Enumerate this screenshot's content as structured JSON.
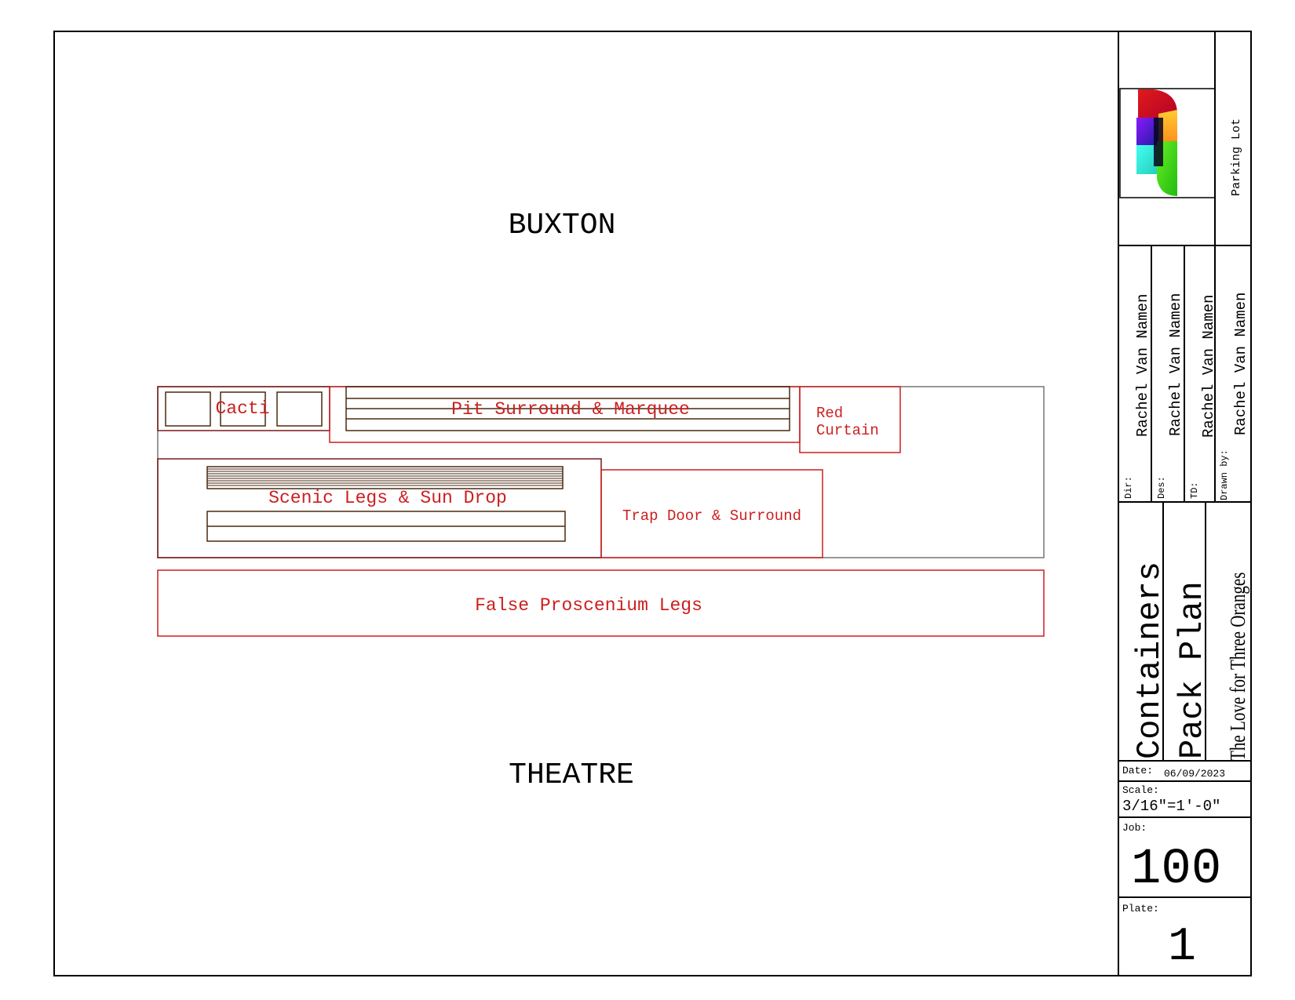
{
  "plan": {
    "top_label": "BUXTON",
    "bottom_label": "THEATRE",
    "containers": {
      "cacti": "Cacti",
      "pit": "Pit Surround & Marquee",
      "red_curtain_line1": "Red",
      "red_curtain_line2": "Curtain",
      "scenic": "Scenic Legs & Sun Drop",
      "trap": "Trap Door & Surround",
      "false_pros": "False Proscenium Legs"
    }
  },
  "title_block": {
    "parking_lot": "Parking Lot",
    "dir_label": "Dir:",
    "dir_name": "Rachel Van Namen",
    "des_label": "Des:",
    "des_name": "Rachel Van Namen",
    "td_label": "TD:",
    "td_name": "Rachel Van Namen",
    "drawn_label": "Drawn by:",
    "drawn_name": "Rachel Van Namen",
    "title_line1": "Containers",
    "title_line2": "Pack Plan",
    "production": "The Love for Three Oranges",
    "date_label": "Date:",
    "date_value": "06/09/2023",
    "scale_label": "Scale:",
    "scale_value": "3/16\"=1'-0\"",
    "job_label": "Job:",
    "job_value": "100",
    "plate_label": "Plate:",
    "plate_value": "1"
  },
  "colors": {
    "container_red": "#cc1f1f",
    "inner_brown": "#4a2a10",
    "line": "#000000",
    "truck_outline": "#777777"
  },
  "icons": {
    "logo": "theatre-logo"
  }
}
